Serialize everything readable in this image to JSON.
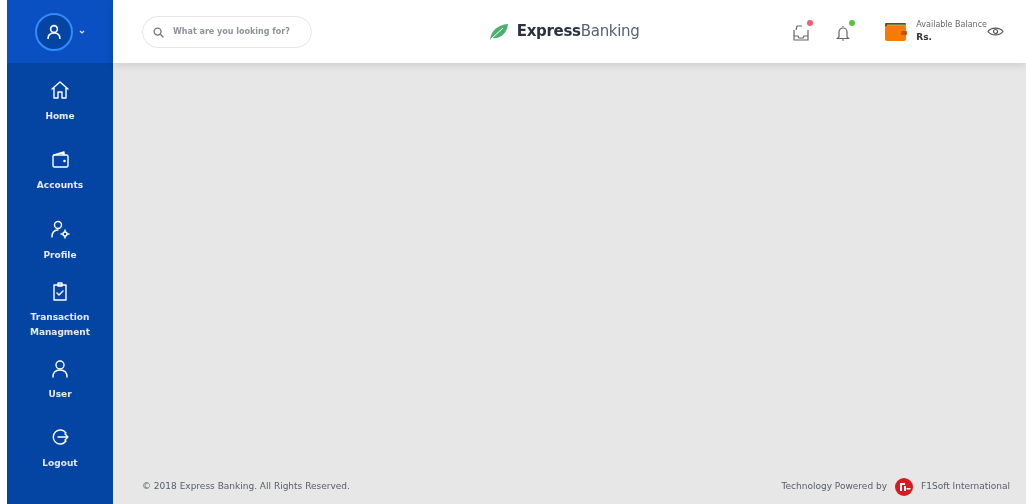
{
  "header": {
    "search": {
      "placeholder": "What are you looking for?"
    },
    "logo": "**Express**Banking",
    "notifications": [
      {
        "kind": "inbox",
        "color": "#f25c6b"
      },
      {
        "kind": "bell",
        "color": "#5cc23f"
      }
    ],
    "balance": {
      "label": "Available Balance",
      "value": "Rs."
    }
  },
  "sidebar": {
    "items": [
      {
        "kind": "home",
        "label": "Home"
      },
      {
        "kind": "wallet",
        "label": "Accounts"
      },
      {
        "kind": "profile",
        "label": "Profile"
      },
      {
        "kind": "clipboard",
        "label": "Transaction Managment"
      },
      {
        "kind": "user",
        "label": "User"
      },
      {
        "kind": "logout",
        "label": "Logout"
      }
    ]
  },
  "footer": {
    "copyright": "© 2018 Express Banking. All Rights Reserved.",
    "powered_by": "Technology Powered by",
    "company": "F1Soft International"
  }
}
